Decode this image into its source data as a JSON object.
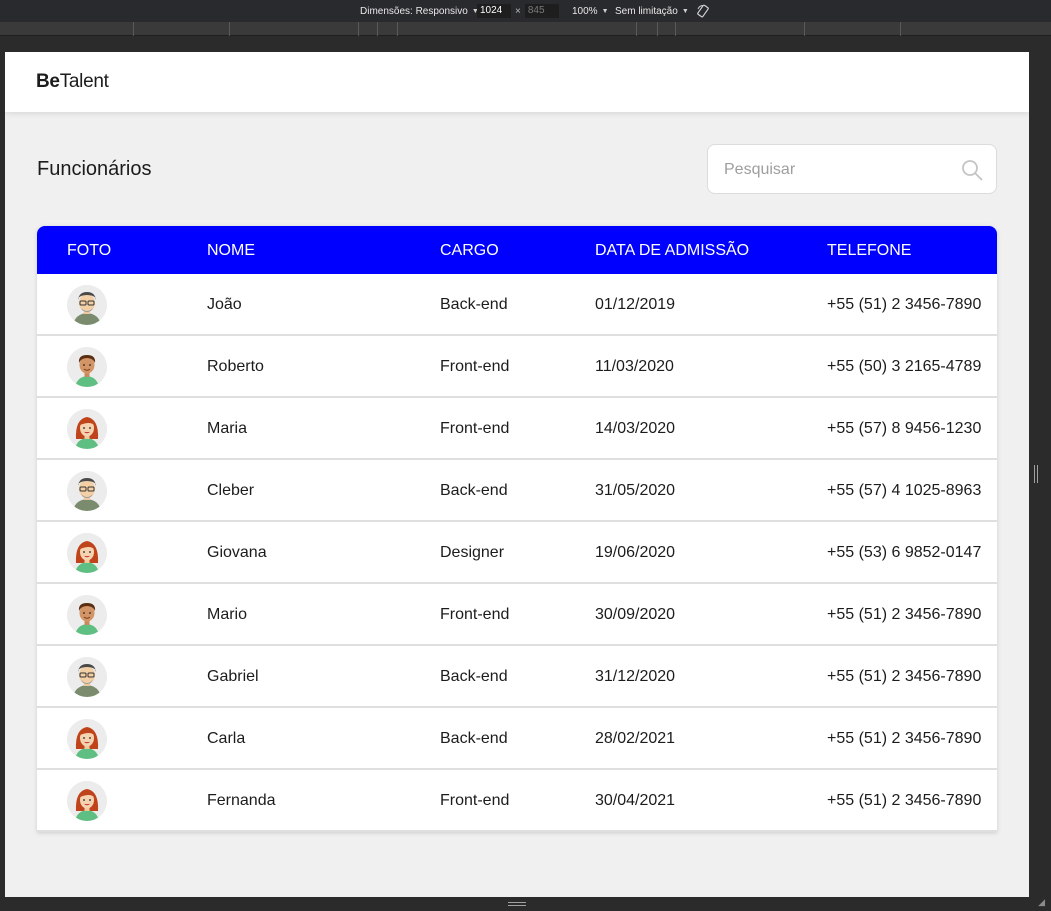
{
  "devtools": {
    "dimensions_label": "Dimensões: Responsivo",
    "width": "1024",
    "times": "×",
    "height": "845",
    "zoom": "100%",
    "throttle": "Sem limitação"
  },
  "app": {
    "logo_bold": "Be",
    "logo_rest": "Talent"
  },
  "page": {
    "title": "Funcionários"
  },
  "search": {
    "placeholder": "Pesquisar",
    "value": ""
  },
  "table": {
    "columns": [
      "FOTO",
      "NOME",
      "CARGO",
      "DATA DE ADMISSÃO",
      "TELEFONE"
    ],
    "rows": [
      {
        "name": "João",
        "role": "Back-end",
        "date": "01/12/2019",
        "phone": "+55 (51) 2 3456-7890",
        "avatar": "older-man-avatar"
      },
      {
        "name": "Roberto",
        "role": "Front-end",
        "date": "11/03/2020",
        "phone": "+55 (50) 3 2165-4789",
        "avatar": "young-man-avatar"
      },
      {
        "name": "Maria",
        "role": "Front-end",
        "date": "14/03/2020",
        "phone": "+55 (57) 8 9456-1230",
        "avatar": "woman-avatar"
      },
      {
        "name": "Cleber",
        "role": "Back-end",
        "date": "31/05/2020",
        "phone": "+55 (57) 4 1025-8963",
        "avatar": "older-man-avatar"
      },
      {
        "name": "Giovana",
        "role": "Designer",
        "date": "19/06/2020",
        "phone": "+55 (53) 6 9852-0147",
        "avatar": "woman-avatar"
      },
      {
        "name": "Mario",
        "role": "Front-end",
        "date": "30/09/2020",
        "phone": "+55 (51) 2 3456-7890",
        "avatar": "young-man-avatar"
      },
      {
        "name": "Gabriel",
        "role": "Back-end",
        "date": "31/12/2020",
        "phone": "+55 (51) 2 3456-7890",
        "avatar": "older-man-avatar"
      },
      {
        "name": "Carla",
        "role": "Back-end",
        "date": "28/02/2021",
        "phone": "+55 (51) 2 3456-7890",
        "avatar": "woman-avatar"
      },
      {
        "name": "Fernanda",
        "role": "Front-end",
        "date": "30/04/2021",
        "phone": "+55 (51) 2 3456-7890",
        "avatar": "woman-avatar"
      }
    ]
  },
  "colors": {
    "header_blue": "#0000ff",
    "background": "#f0f0f0"
  }
}
